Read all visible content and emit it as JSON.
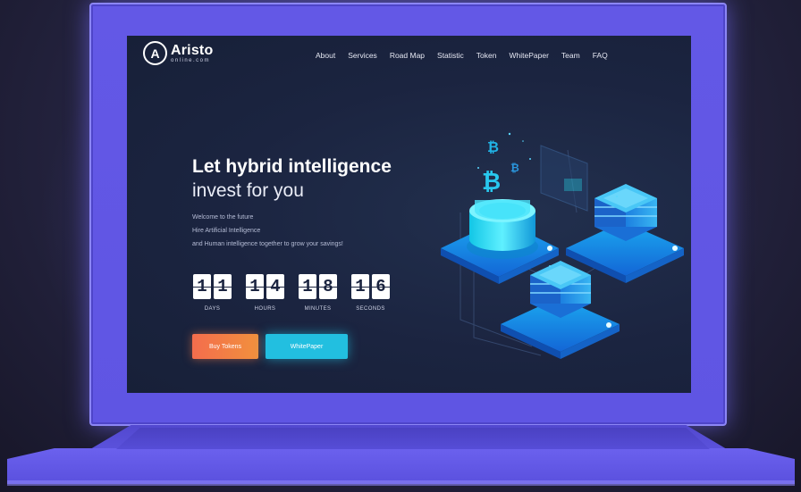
{
  "logo": {
    "name": "Aristo",
    "sub": "online.com",
    "glyph": "A"
  },
  "nav": [
    "About",
    "Services",
    "Road Map",
    "Statistic",
    "Token",
    "WhitePaper",
    "Team",
    "FAQ"
  ],
  "hero": {
    "title_line1": "Let hybrid intelligence",
    "title_line2": "invest for you",
    "desc_line1": "Welcome to the future",
    "desc_line2": "Hire Artificial Intelligence",
    "desc_line3": "and Human intelligence together to grow your savings!"
  },
  "countdown": [
    {
      "d1": "1",
      "d2": "1",
      "label": "DAYS"
    },
    {
      "d1": "1",
      "d2": "4",
      "label": "HOURS"
    },
    {
      "d1": "1",
      "d2": "8",
      "label": "MINUTES"
    },
    {
      "d1": "1",
      "d2": "6",
      "label": "SECONDS"
    }
  ],
  "buttons": {
    "buy": "Buy Tokens",
    "whitepaper": "WhitePaper"
  },
  "illustration": {
    "symbol": "₿"
  },
  "colors": {
    "frame": "#5f55e3",
    "screen": "#1b2440",
    "buy_start": "#f36d4d",
    "buy_end": "#f2903d",
    "cyan": "#22bfe0"
  }
}
